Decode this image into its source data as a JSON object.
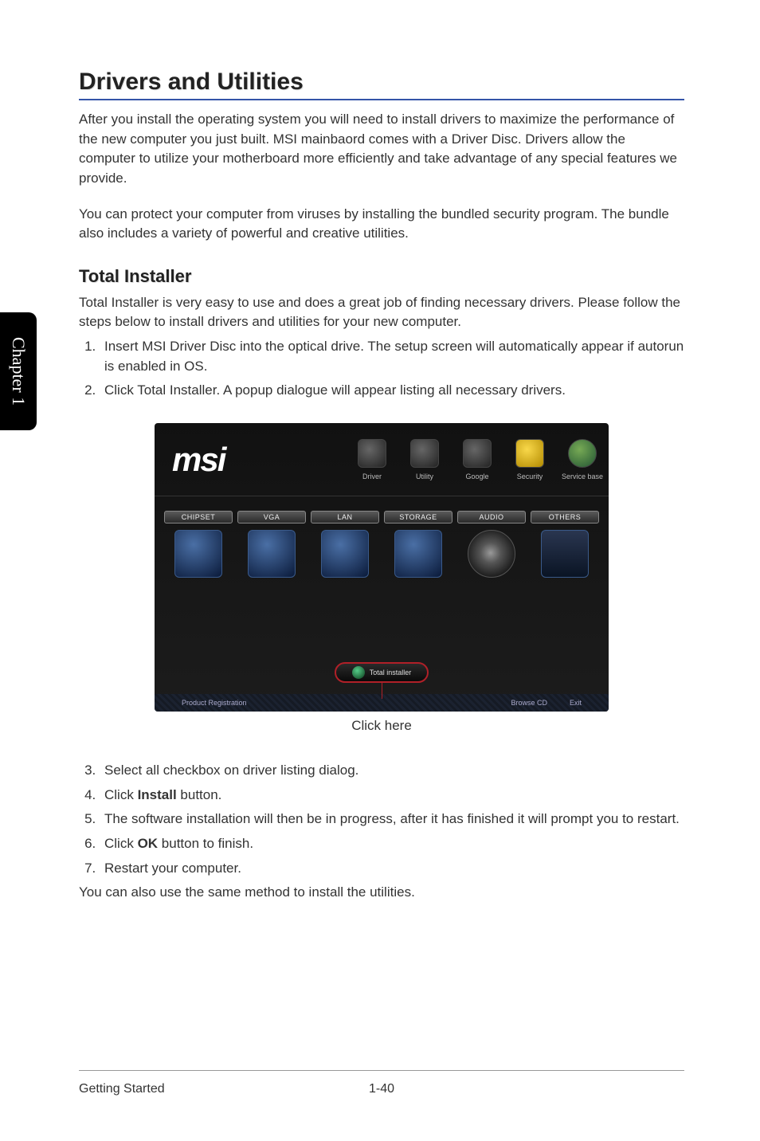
{
  "chapter_tab": "Chapter 1",
  "section_title": "Drivers and Utilities",
  "intro_p1": "After you install the operating system you will need to install drivers to maximize the performance of the new computer you just built. MSI mainbaord comes with a Driver Disc. Drivers allow the computer to utilize your motherboard more efficiently and take advantage of any special features we provide.",
  "intro_p2": "You can protect your computer from viruses by installing the bundled security program. The bundle also includes a variety of powerful and creative utilities.",
  "subsection_title": "Total Installer",
  "sub_intro": "Total Installer is very easy to use and does a great job of finding necessary drivers. Please follow the steps below to install drivers and utilities for your new computer.",
  "steps_first": [
    "Insert MSI Driver Disc into the optical drive. The setup screen will automatically appear if autorun is enabled in OS.",
    "Click Total Installer. A popup dialogue will appear listing all necessary drivers."
  ],
  "installer": {
    "logo": "msi",
    "topnav": [
      {
        "label": "Driver"
      },
      {
        "label": "Utility"
      },
      {
        "label": "Google"
      },
      {
        "label": "Security"
      },
      {
        "label": "Service base"
      }
    ],
    "categories": [
      "CHIPSET",
      "VGA",
      "LAN",
      "STORAGE",
      "AUDIO",
      "OTHERS"
    ],
    "total_button": "Total installer",
    "bottom_left": "Product Registration",
    "bottom_browse": "Browse CD",
    "bottom_exit": "Exit"
  },
  "click_here": "Click here",
  "steps_second": [
    {
      "n": "3.",
      "text": "Select all checkbox on driver listing dialog."
    },
    {
      "n": "4.",
      "pre": "Click ",
      "bold": "Install",
      "post": " button."
    },
    {
      "n": "5.",
      "text": "The software installation will then be in progress, after it has finished it will prompt you to restart."
    },
    {
      "n": "6.",
      "pre": "Click ",
      "bold": "OK",
      "post": " button to finish."
    },
    {
      "n": "7.",
      "text": "Restart your computer."
    }
  ],
  "closing": "You can also use the same method to install the utilities.",
  "footer_left": "Getting Started",
  "footer_page": "1-40"
}
